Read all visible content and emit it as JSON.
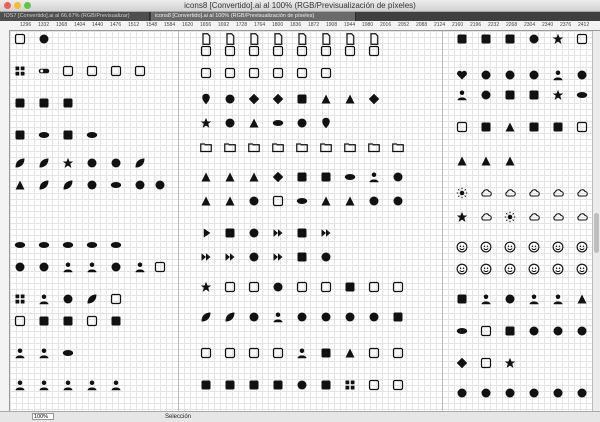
{
  "window": {
    "title": "icons8 [Convertido].ai al 100% (RGB/Previsualización de píxeles)"
  },
  "tabs": [
    {
      "label": "IOS7 [Convertido].ai al 66,67% (RGB/Previsualizar)",
      "active": false
    },
    {
      "label": "icons8 [Convertido].ai al 100% (RGB/Previsualización de píxeles)",
      "active": true
    }
  ],
  "ruler": {
    "ticks": [
      "1296",
      "1332",
      "1368",
      "1404",
      "1440",
      "1476",
      "1512",
      "1548",
      "1584",
      "1620",
      "1656",
      "1692",
      "1728",
      "1764",
      "1800",
      "1836",
      "1872",
      "1908",
      "1944",
      "1980",
      "2016",
      "2052",
      "2088",
      "2124",
      "2160",
      "2196",
      "2232",
      "2268",
      "2304",
      "2340",
      "2376",
      "2412"
    ]
  },
  "status": {
    "zoom": "100%",
    "tool": "Selección"
  },
  "colors": {
    "icon": "#111111",
    "canvas": "#ffffff",
    "grid": "#e4e4e4"
  }
}
